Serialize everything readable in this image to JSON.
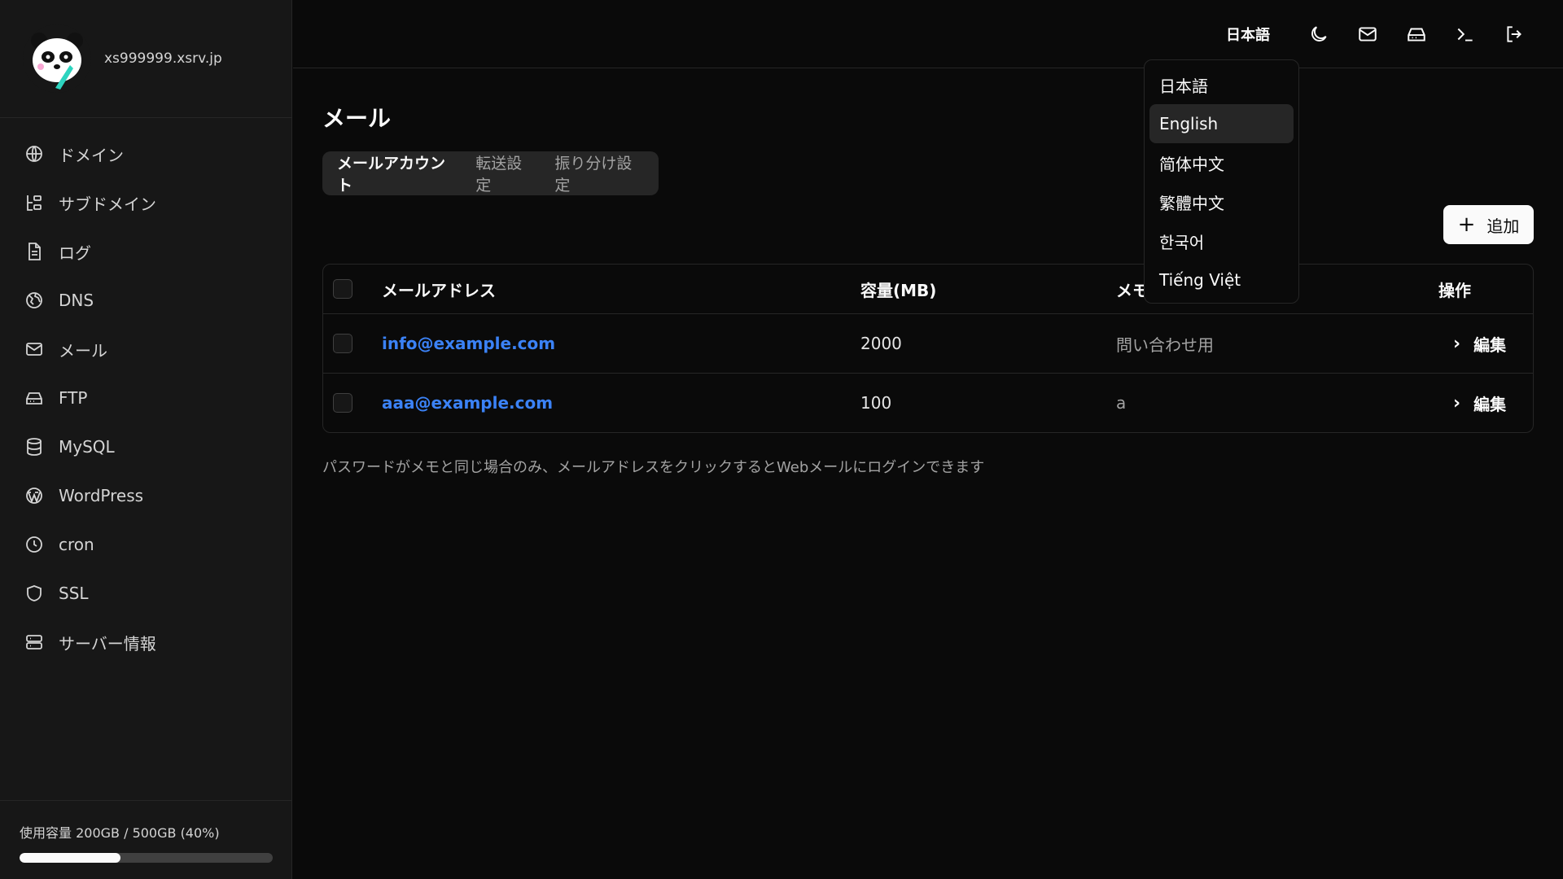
{
  "sidebar": {
    "host": "xs999999.xsrv.jp",
    "items": [
      {
        "label": "ドメイン",
        "icon": "globe-icon"
      },
      {
        "label": "サブドメイン",
        "icon": "subdomain-icon"
      },
      {
        "label": "ログ",
        "icon": "file-text-icon"
      },
      {
        "label": "DNS",
        "icon": "dns-globe-icon"
      },
      {
        "label": "メール",
        "icon": "mail-icon"
      },
      {
        "label": "FTP",
        "icon": "hard-drive-icon"
      },
      {
        "label": "MySQL",
        "icon": "database-icon"
      },
      {
        "label": "WordPress",
        "icon": "wordpress-icon"
      },
      {
        "label": "cron",
        "icon": "clock-icon"
      },
      {
        "label": "SSL",
        "icon": "shield-icon"
      },
      {
        "label": "サーバー情報",
        "icon": "server-icon"
      }
    ],
    "usage_text": "使用容量 200GB / 500GB (40%)",
    "usage_fraction": 0.4
  },
  "topbar": {
    "language": "日本語",
    "icons": [
      "moon-icon",
      "mail-icon",
      "inbox-icon",
      "terminal-icon",
      "logout-icon"
    ]
  },
  "language_menu": {
    "items": [
      "日本語",
      "English",
      "简体中文",
      "繁體中文",
      "한국어",
      "Tiếng Việt"
    ],
    "highlighted": "English"
  },
  "main": {
    "title": "メール",
    "tabs": [
      "メールアカウント",
      "転送設定",
      "振り分け設定"
    ],
    "active_tab": "メールアカウント",
    "add_label": "追加",
    "columns": {
      "email": "メールアドレス",
      "capacity": "容量(MB)",
      "memo": "メモ",
      "ops": "操作"
    },
    "rows": [
      {
        "email": "info@example.com",
        "capacity": "2000",
        "memo": "問い合わせ用",
        "action": "編集"
      },
      {
        "email": "aaa@example.com",
        "capacity": "100",
        "memo": "a",
        "action": "編集"
      }
    ],
    "note": "パスワードがメモと同じ場合のみ、メールアドレスをクリックするとWebメールにログインできます"
  },
  "colors": {
    "link": "#3b82f6",
    "background": "#0a0a0a",
    "sidebar": "#171717"
  }
}
